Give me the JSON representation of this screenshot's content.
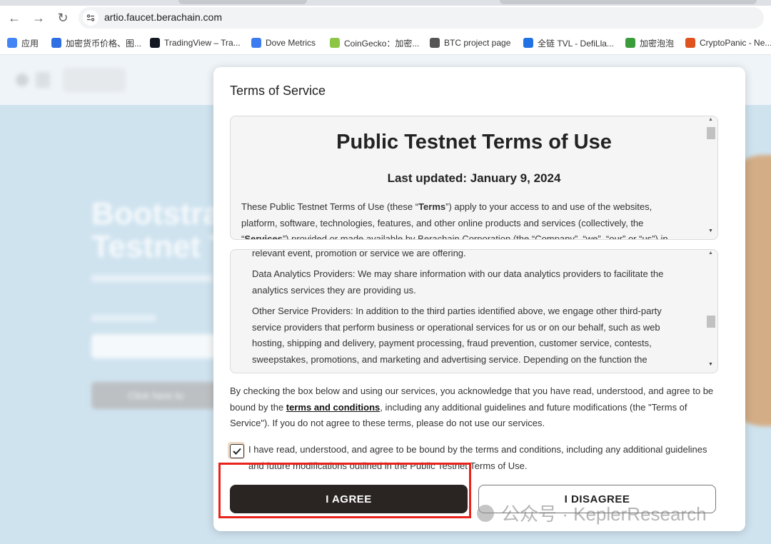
{
  "browser": {
    "url": "artio.faucet.berachain.com",
    "bookmarks": [
      {
        "label": "应用",
        "icon": "apps-grid-icon",
        "color": "#4285f4"
      },
      {
        "label": "加密货币价格、图...",
        "icon": "coin-icon",
        "color": "#2f6fe4"
      },
      {
        "label": "TradingView – Tra...",
        "icon": "tradingview-icon",
        "color": "#131722"
      },
      {
        "label": "Dove Metrics",
        "icon": "dove-metrics-icon",
        "color": "#3d7bf0"
      },
      {
        "label": "CoinGecko：加密...",
        "icon": "coingecko-icon",
        "color": "#8dc647"
      },
      {
        "label": "BTC project page",
        "icon": "btc-icon",
        "color": "#555555"
      },
      {
        "label": "全链 TVL - DefiLla...",
        "icon": "defillama-icon",
        "color": "#2172e5"
      },
      {
        "label": "加密泡泡",
        "icon": "bubbles-icon",
        "color": "#3a9d3a"
      },
      {
        "label": "CryptoPanic - Ne...",
        "icon": "cryptopanic-icon",
        "color": "#e0531f"
      }
    ]
  },
  "background": {
    "hero_title_line1": "Bootstra",
    "hero_title_line2": "Testnet T",
    "hero_button": "Click here to"
  },
  "modal": {
    "title": "Terms of Service",
    "doc1": {
      "heading": "Public Testnet Terms of Use",
      "updated": "Last updated: January 9, 2024",
      "p1_pre": "These Public Testnet Terms of Use (these “",
      "p1_terms": "Terms",
      "p1_post": "”) apply to your access to and use of the websites, platform, software, technologies, features, and other online products and services (collectively, the “",
      "p1_services": "Services",
      "p1_tail": "”) provided or made available by Berachain Corporation (the “Company”, “we”, “our” or “us”) in"
    },
    "doc2": {
      "p0": "relevant event, promotion or service we are offering.",
      "p1": "Data Analytics Providers: We may share information with our data analytics providers to facilitate the analytics services they are providing us.",
      "p2": "Other Service Providers: In addition to the third parties identified above, we engage other third-party service providers that perform business or operational services for us or on our behalf, such as web hosting, shipping and delivery, payment processing, fraud prevention, customer service, contests, sweepstakes, promotions, and marketing and advertising service. Depending on the function the"
    },
    "consent_pre": "By checking the box below and using our services, you acknowledge that you have read, understood, and agree to be bound by the ",
    "consent_link": "terms and conditions",
    "consent_post": ", including any additional guidelines and future modifications (the \"Terms of Service\"). If you do not agree to these terms, please do not use our services.",
    "checkbox_label": "I have read, understood, and agree to be bound by the terms and conditions, including any additional guidelines and future modifications outlined in the Public Testnet Terms of Use.",
    "checkbox_checked": true,
    "agree_label": "I AGREE",
    "disagree_label": "I DISAGREE"
  },
  "watermark": "公众号 · KeplerResearch",
  "colors": {
    "agree_bg": "#2a2523",
    "highlight": "#e8231c",
    "page_bg": "#cfe3ef"
  }
}
